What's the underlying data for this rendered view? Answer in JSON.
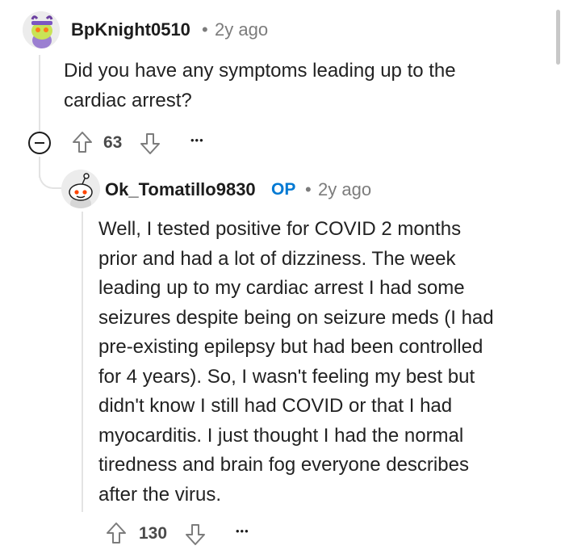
{
  "comment_1": {
    "username": "BpKnight0510",
    "separator": "•",
    "time": "2y ago",
    "body_lines": [
      "Did you have any symptoms leading up to the",
      "cardiac arrest?"
    ],
    "votes": "63",
    "more": "•••"
  },
  "comment_2": {
    "username": "Ok_Tomatillo9830",
    "op_badge": "OP",
    "separator": "•",
    "time": "2y ago",
    "body_lines": [
      "Well, I tested positive for COVID 2 months",
      "prior and had a lot of dizziness. The week",
      "leading up to my cardiac arrest I had some",
      "seizures despite being on seizure meds (I had",
      "pre-existing epilepsy but had been controlled",
      "for 4 years). So, I wasn't feeling my best but",
      "didn't know I still had COVID or that I had",
      "myocarditis. I just thought I had the normal",
      "tiredness and brain fog everyone describes",
      "after the virus."
    ],
    "votes": "130",
    "more": "•••"
  },
  "icons": {
    "collapse": "minus-circle-icon",
    "upvote": "arrow-up-icon",
    "downvote": "arrow-down-icon",
    "more": "ellipsis-icon"
  },
  "colors": {
    "op_badge": "#0079d3",
    "meta_text": "#7c7c7c",
    "thread_line": "#e3e3e3"
  }
}
